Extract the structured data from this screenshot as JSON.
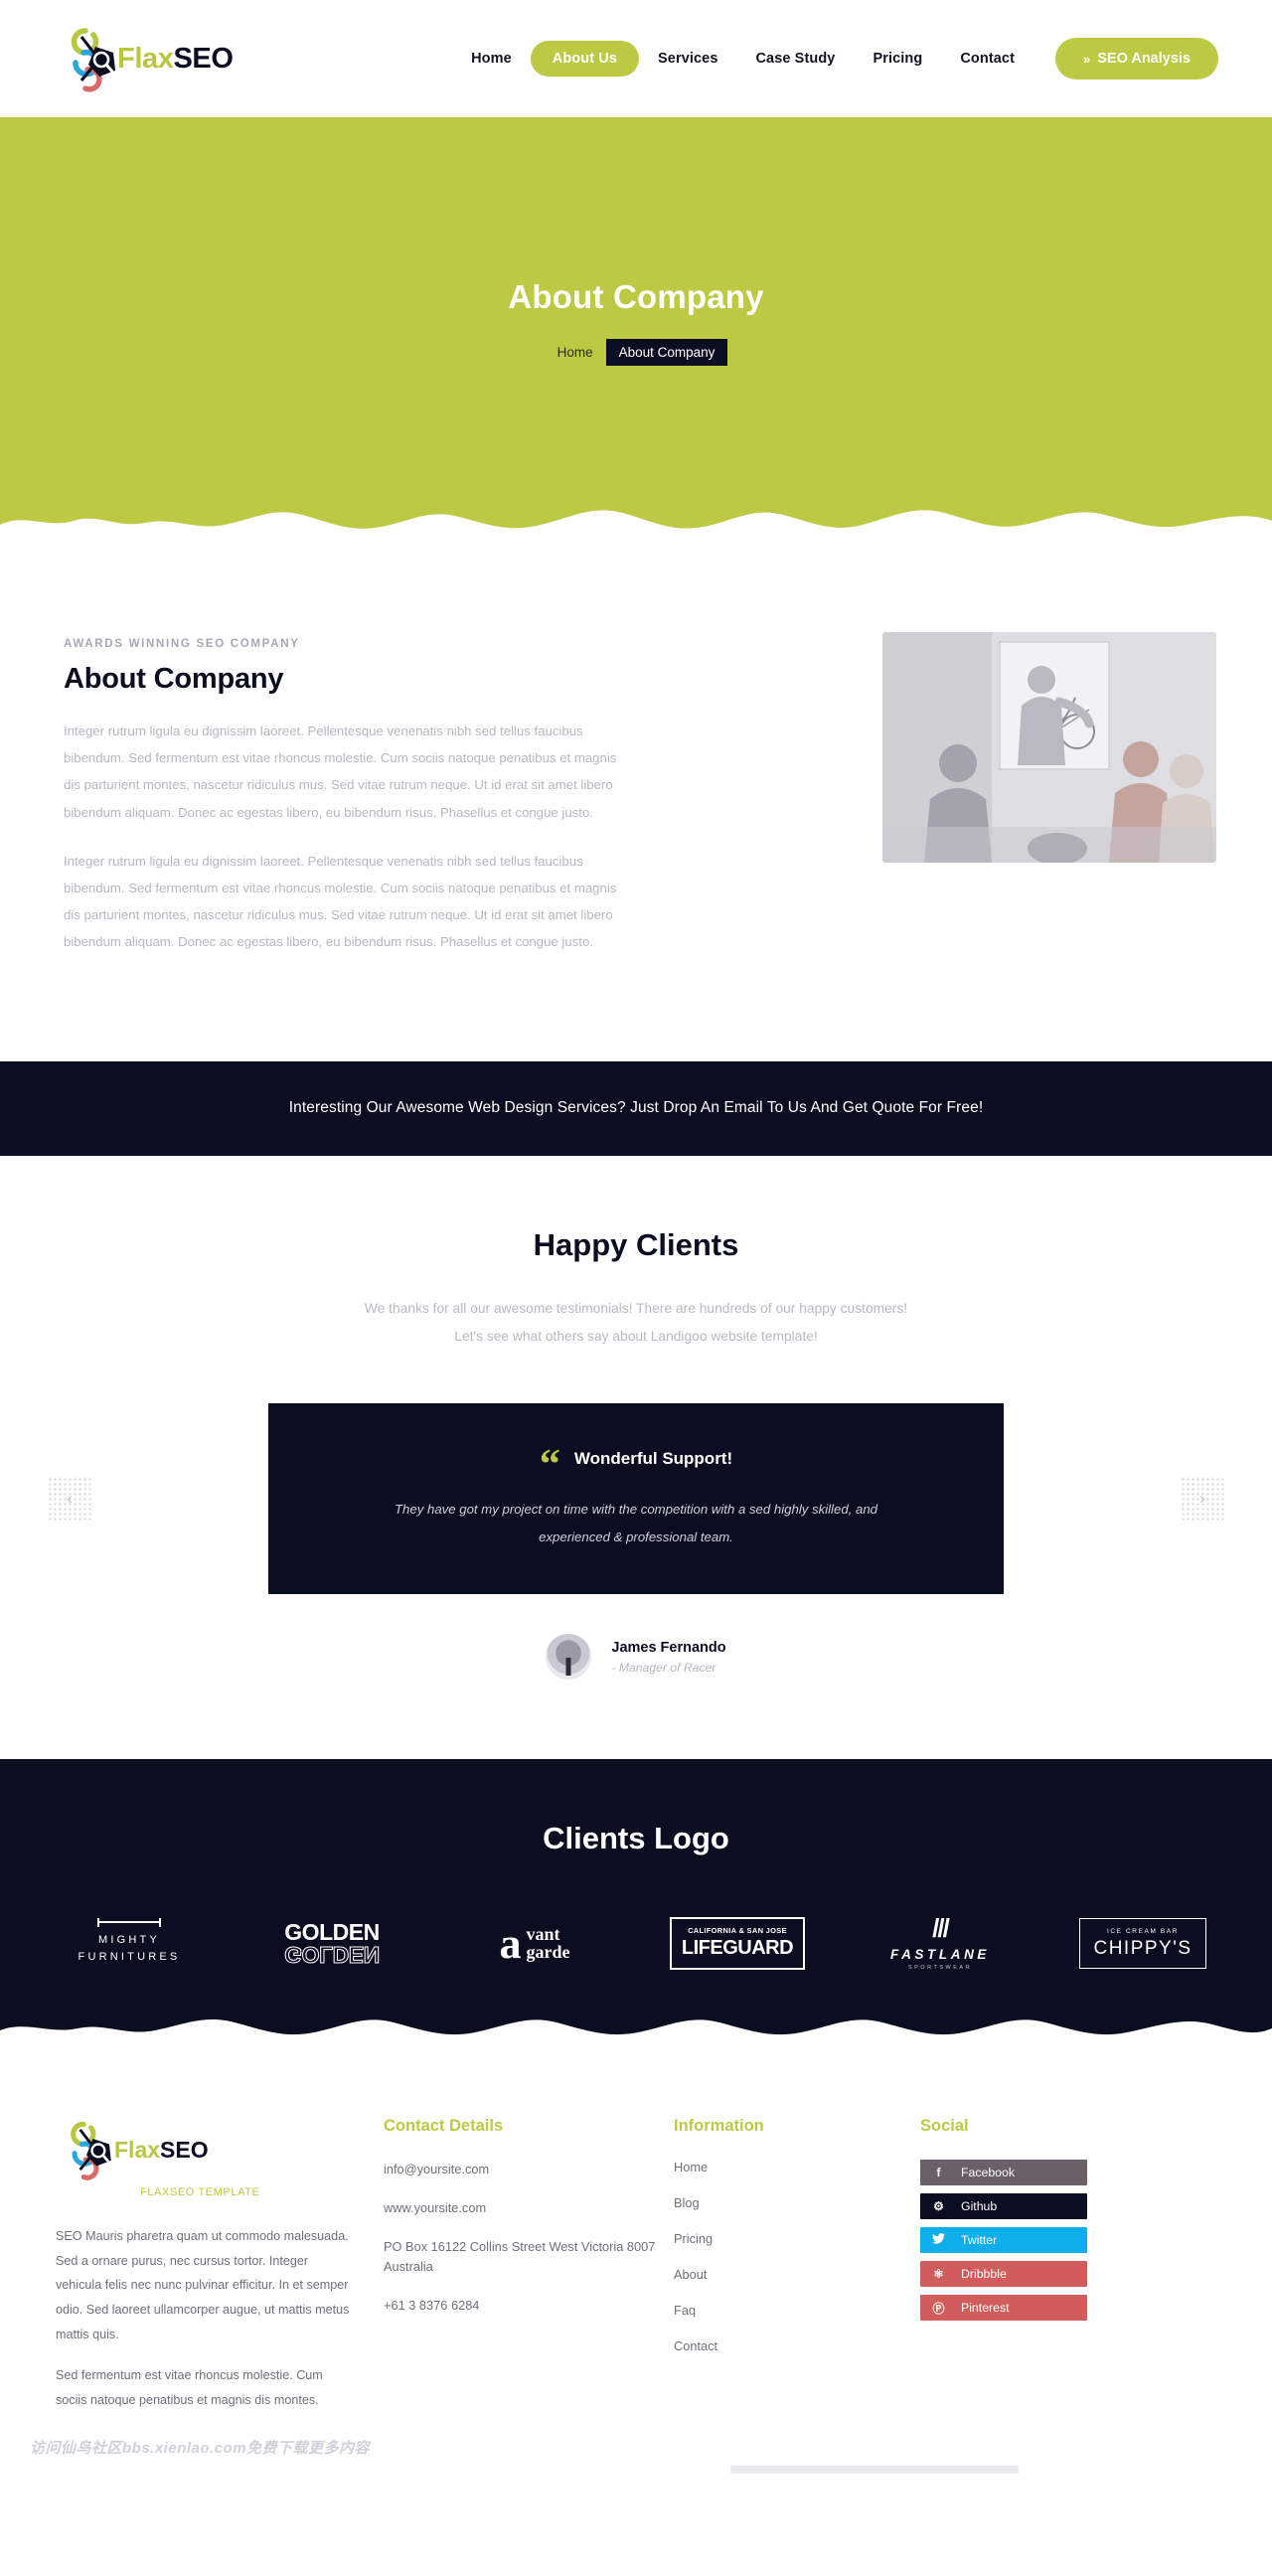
{
  "brand": {
    "name_part1": "Flax",
    "name_part2": "SEO",
    "tagline": "FLAXSEO TEMPLATE"
  },
  "header": {
    "nav": [
      {
        "label": "Home",
        "active": false
      },
      {
        "label": "About Us",
        "active": true
      },
      {
        "label": "Services",
        "active": false
      },
      {
        "label": "Case Study",
        "active": false
      },
      {
        "label": "Pricing",
        "active": false
      },
      {
        "label": "Contact",
        "active": false
      }
    ],
    "cta_button": "SEO Analysis",
    "cta_icon": "double-chevron-right-icon"
  },
  "hero": {
    "title": "About Company",
    "breadcrumb_home": "Home",
    "breadcrumb_current": "About Company",
    "bg_color": "#bdc843"
  },
  "about": {
    "eyebrow": "AWARDS WINNING SEO COMPANY",
    "heading": "About Company",
    "paragraph1": "Integer rutrum ligula eu dignissim laoreet. Pellentesque venenatis nibh sed tellus faucibus bibendum. Sed fermentum est vitae rhoncus molestie. Cum sociis natoque penatibus et magnis dis parturient montes, nascetur ridiculus mus. Sed vitae rutrum neque. Ut id erat sit amet libero bibendum aliquam. Donec ac egestas libero, eu bibendum risus. Phasellus et congue justo.",
    "paragraph2": "Integer rutrum ligula eu dignissim laoreet. Pellentesque venenatis nibh sed tellus faucibus bibendum. Sed fermentum est vitae rhoncus molestie. Cum sociis natoque penatibus et magnis dis parturient montes, nascetur ridiculus mus. Sed vitae rutrum neque. Ut id erat sit amet libero bibendum aliquam. Donec ac egestas libero, eu bibendum risus. Phasellus et congue justo.",
    "image_alt": "team-meeting-photo"
  },
  "cta_band": {
    "text": "Interesting Our Awesome Web Design Services? Just Drop An Email To Us And Get Quote For Free!",
    "bg_color": "#0b0d21"
  },
  "testimonials": {
    "section_title": "Happy Clients",
    "subtitle_line1": "We thanks for all our awesome testimonials! There are hundreds of our happy customers!",
    "subtitle_line2": "Let's see what others say about Landigoo website template!",
    "card": {
      "quote_icon": "quote-mark-icon",
      "title": "Wonderful Support!",
      "body_line1": "They have got my project on time with the competition with a sed highly skilled, and",
      "body_line2": "experienced & professional team."
    },
    "author_name": "James Fernando",
    "author_role": "- Manager of Racer",
    "prev_label": "‹",
    "next_label": "›"
  },
  "clients_logos": {
    "title": "Clients Logo",
    "bg_color": "#0b0d21",
    "items": [
      {
        "id": "mighty-furnitures",
        "line1": "MIGHTY",
        "line2": "FURNITURES"
      },
      {
        "id": "golden",
        "line1": "GOLDEN",
        "line2": "GOLDEN"
      },
      {
        "id": "avant-garde",
        "line1": "vant",
        "line2": "garde",
        "initial": "a"
      },
      {
        "id": "lifeguard",
        "line1": "CALIFORNIA & SAN JOSE",
        "line2": "LIFEGUARD"
      },
      {
        "id": "fastlane",
        "mark": "///",
        "line1": "FASTLANE",
        "line2": "SPORTSWEAR"
      },
      {
        "id": "chippys",
        "line1": "ICE CREAM BAR",
        "line2": "CHIPPY'S"
      }
    ]
  },
  "footer": {
    "about_text1": "SEO Mauris pharetra quam ut commodo malesuada. Sed a ornare purus, nec cursus tortor. Integer vehicula felis nec nunc pulvinar efficitur. In et semper odio. Sed laoreet ullamcorper augue, ut mattis metus mattis quis.",
    "about_text2": "Sed fermentum est vitae rhoncus molestie. Cum sociis natoque penatibus et magnis dis montes.",
    "contact": {
      "heading": "Contact Details",
      "email": "info@yoursite.com",
      "website": "www.yoursite.com",
      "address": "PO Box 16122 Collins Street West Victoria 8007 Australia",
      "phone": "+61 3 8376 6284"
    },
    "information": {
      "heading": "Information",
      "links": [
        "Home",
        "Blog",
        "Pricing",
        "About",
        "Faq",
        "Contact"
      ]
    },
    "social": {
      "heading": "Social",
      "items": [
        {
          "label": "Facebook",
          "icon": "facebook-icon",
          "glyph": "f",
          "color": "#6b5f68"
        },
        {
          "label": "Github",
          "icon": "github-icon",
          "glyph": "⚈",
          "color": "#0b0d21"
        },
        {
          "label": "Twitter",
          "icon": "twitter-icon",
          "glyph": "ᵗ",
          "color": "#0daeea"
        },
        {
          "label": "Dribbble",
          "icon": "dribbble-icon",
          "glyph": "⊛",
          "color": "#d05c5c"
        },
        {
          "label": "Pinterest",
          "icon": "pinterest-icon",
          "glyph": "Ⓟ",
          "color": "#d05c5c"
        }
      ]
    }
  },
  "watermark": "访问仙鸟社区bbs.xienlao.com免费下载更多内容"
}
